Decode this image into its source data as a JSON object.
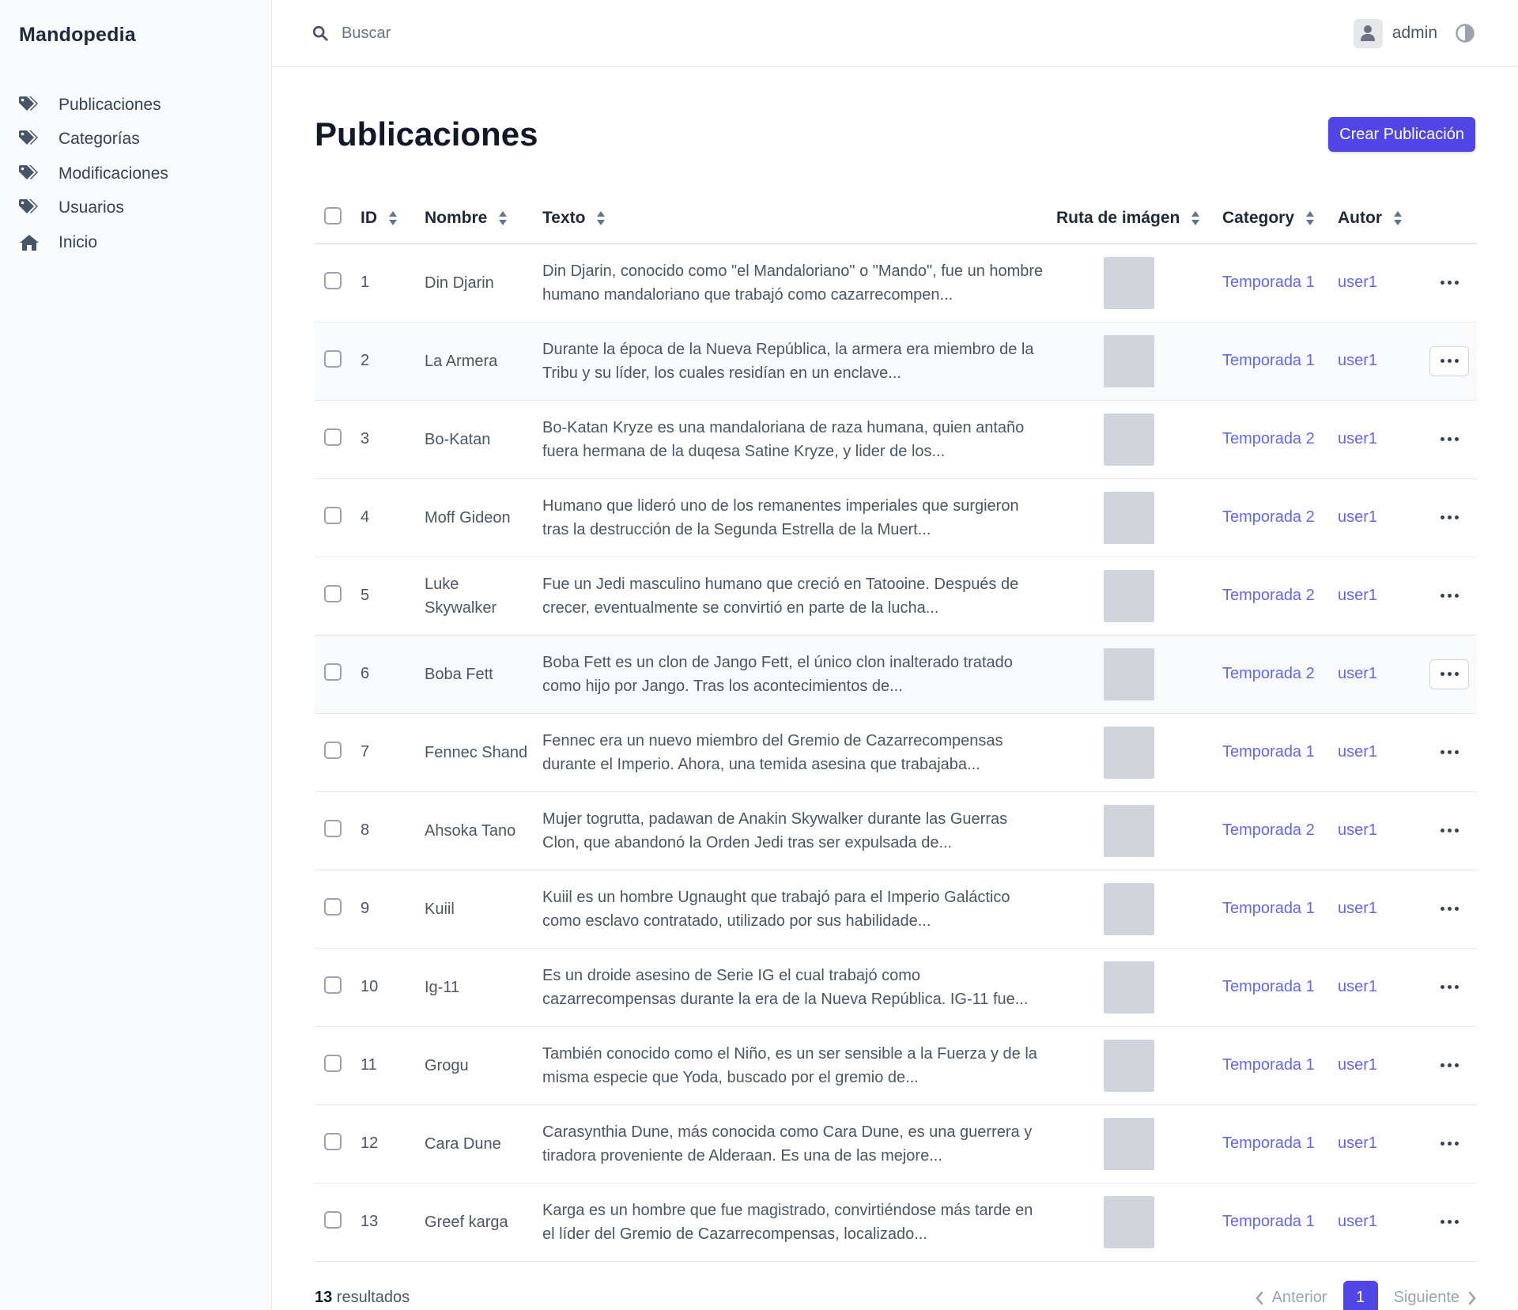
{
  "sidebar": {
    "brand": "Mandopedia",
    "items": [
      {
        "label": "Publicaciones",
        "icon": "tags-icon"
      },
      {
        "label": "Categorías",
        "icon": "tags-icon"
      },
      {
        "label": "Modificaciones",
        "icon": "tags-icon"
      },
      {
        "label": "Usuarios",
        "icon": "tags-icon"
      },
      {
        "label": "Inicio",
        "icon": "home-icon"
      }
    ]
  },
  "topbar": {
    "search_placeholder": "Buscar",
    "user_name": "admin"
  },
  "main": {
    "title": "Publicaciones",
    "create_button": "Crear Publicación"
  },
  "table": {
    "columns": [
      "ID",
      "Nombre",
      "Texto",
      "Ruta de imágen",
      "Category",
      "Autor"
    ],
    "rows": [
      {
        "id": "1",
        "name": "Din Djarin",
        "text": "Din Djarin, conocido como \"el Mandaloriano\" o \"Mando\", fue un hombre humano mandaloriano que trabajó como cazarrecompen...",
        "category": "Temporada 1",
        "author": "user1"
      },
      {
        "id": "2",
        "name": "La Armera",
        "text": "Durante la época de la Nueva República, la armera era miembro de la Tribu y su líder, los cuales residían en un enclave...",
        "category": "Temporada 1",
        "author": "user1"
      },
      {
        "id": "3",
        "name": "Bo-Katan",
        "text": "Bo-Katan Kryze es una mandaloriana de raza humana, quien antaño fuera hermana de la duqesa Satine Kryze, y lider de los...",
        "category": "Temporada 2",
        "author": "user1"
      },
      {
        "id": "4",
        "name": "Moff Gideon",
        "text": "Humano que lideró uno de los remanentes imperiales que surgieron tras la destrucción de la Segunda Estrella de la Muert...",
        "category": "Temporada 2",
        "author": "user1"
      },
      {
        "id": "5",
        "name": "Luke Skywalker",
        "text": "Fue un Jedi masculino humano que creció en Tatooine. Después de crecer, eventualmente se convirtió en parte de la lucha...",
        "category": "Temporada 2",
        "author": "user1"
      },
      {
        "id": "6",
        "name": "Boba Fett",
        "text": "Boba Fett es un clon de Jango Fett, el único clon inalterado tratado como hijo por Jango. Tras los acontecimientos de...",
        "category": "Temporada 2",
        "author": "user1"
      },
      {
        "id": "7",
        "name": "Fennec Shand",
        "text": "Fennec era un nuevo miembro del Gremio de Cazarrecompensas durante el Imperio. Ahora, una temida asesina que trabajaba...",
        "category": "Temporada 1",
        "author": "user1"
      },
      {
        "id": "8",
        "name": "Ahsoka Tano",
        "text": "Mujer togrutta, padawan de Anakin Skywalker durante las Guerras Clon, que abandonó la Orden Jedi tras ser expulsada de...",
        "category": "Temporada 2",
        "author": "user1"
      },
      {
        "id": "9",
        "name": "Kuiil",
        "text": "Kuiil es un hombre Ugnaught que trabajó para el Imperio Galáctico como esclavo contratado, utilizado por sus habilidade...",
        "category": "Temporada 1",
        "author": "user1"
      },
      {
        "id": "10",
        "name": "Ig-11",
        "text": "Es un droide asesino de Serie IG el cual trabajó como cazarrecompensas durante la era de la Nueva República. IG-11 fue...",
        "category": "Temporada 1",
        "author": "user1"
      },
      {
        "id": "11",
        "name": "Grogu",
        "text": "También conocido como el Niño, es un ser sensible a la Fuerza y de la misma especie que Yoda, buscado por el gremio de...",
        "category": "Temporada 1",
        "author": "user1"
      },
      {
        "id": "12",
        "name": "Cara Dune",
        "text": "Carasynthia Dune, más conocida como Cara Dune, es una guerrera y tiradora proveniente de Alderaan. Es una de las mejore...",
        "category": "Temporada 1",
        "author": "user1"
      },
      {
        "id": "13",
        "name": "Greef karga",
        "text": "Karga es un hombre que fue magistrado, convirtiéndose más tarde en el líder del Gremio de Cazarrecompensas, localizado...",
        "category": "Temporada 1",
        "author": "user1"
      }
    ]
  },
  "footer": {
    "result_number": "13",
    "result_label": " resultados",
    "prev_label": "Anterior",
    "next_label": "Siguiente",
    "current_page": "1"
  },
  "colors": {
    "accent": "#4f46e5",
    "link": "#6366f1"
  }
}
